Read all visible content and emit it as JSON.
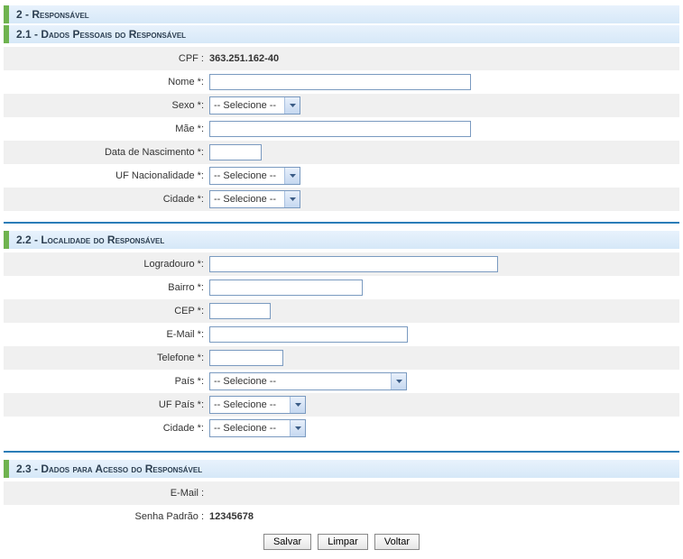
{
  "sec2": {
    "title": "2 - Responsável"
  },
  "sec21": {
    "title": "2.1 - Dados Pessoais do Responsável",
    "cpf_label": "CPF :",
    "cpf_value": "363.251.162-40",
    "nome_label": "Nome *:",
    "sexo_label": "Sexo *:",
    "sexo_value": "-- Selecione --",
    "mae_label": "Mãe *:",
    "dn_label": "Data de Nascimento *:",
    "ufnac_label": "UF Nacionalidade *:",
    "ufnac_value": "-- Selecione --",
    "cidade_label": "Cidade *:",
    "cidade_value": "-- Selecione --"
  },
  "sec22": {
    "title": "2.2 - Localidade do Responsável",
    "logr_label": "Logradouro *:",
    "bairro_label": "Bairro *:",
    "cep_label": "CEP *:",
    "email_label": "E-Mail *:",
    "tel_label": "Telefone *:",
    "pais_label": "País *:",
    "pais_value": "-- Selecione --",
    "ufpais_label": "UF País *:",
    "ufpais_value": "-- Selecione --",
    "cidade_label": "Cidade *:",
    "cidade_value": "-- Selecione --"
  },
  "sec23": {
    "title": "2.3 - Dados para Acesso do Responsável",
    "email_label": "E-Mail :",
    "email_value": "",
    "senha_label": "Senha Padrão :",
    "senha_value": "12345678"
  },
  "buttons": {
    "salvar": "Salvar",
    "limpar": "Limpar",
    "voltar": "Voltar"
  }
}
